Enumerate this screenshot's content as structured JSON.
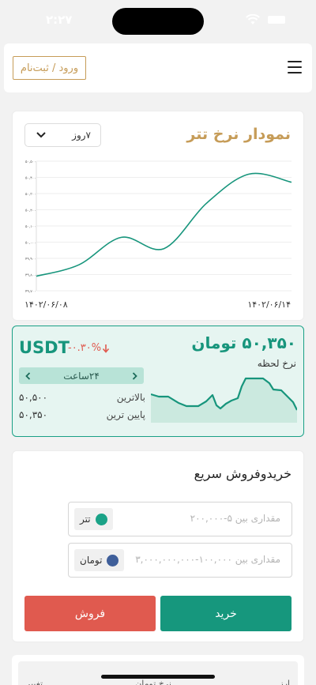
{
  "status_bar": {
    "time": "۲:۲۷"
  },
  "header": {
    "login_label": "ورود / ثبت‌نام"
  },
  "chart_card": {
    "title": "نمودار نرخ تتر",
    "period_selected": "۷روز",
    "start_date": "۱۴۰۲/۰۶/۰۸",
    "end_date": "۱۴۰۲/۰۶/۱۴",
    "y_tick_labels": [
      "۵۰,۵۰۰",
      "۵۰,۴۰۰",
      "۵۰,۳۰۰",
      "۵۰,۲۰۰",
      "۵۰,۱۰۰",
      "۵۰,۰۰۰",
      "۴۹,۹۰۰",
      "۴۹,۸۰۰",
      "۴۹,۷۰۰"
    ],
    "line_color": "#17957c"
  },
  "chart_data": {
    "type": "line",
    "title": "نمودار نرخ تتر",
    "x": [
      "۱۴۰۲/۰۶/۰۸",
      "",
      "",
      "",
      "",
      "",
      "۱۴۰۲/۰۶/۱۴"
    ],
    "series": [
      {
        "values": [
          49790,
          49860,
          50030,
          49960,
          50240,
          50420,
          50370
        ]
      }
    ],
    "ylim": [
      49700,
      50500
    ],
    "grid": true
  },
  "rate_card": {
    "price": "۵۰,۳۵۰ تومان",
    "price_label": "نرخ لحظه",
    "symbol": "USDT",
    "change": "-۰.۳۰%",
    "period_label": "۲۴ساعت",
    "high_label": "بالاترین",
    "high_value": "۵۰,۵۰۰",
    "low_label": "پایین ترین",
    "low_value": "۵۰,۳۵۰",
    "accent_color": "#17957c",
    "negative_color": "#e05a4f"
  },
  "trade_card": {
    "title": "خریدوفروش سریع",
    "tether_field": {
      "placeholder": "مقداری بین ۵-۲۰۰,۰۰۰",
      "unit": "تتر"
    },
    "toman_field": {
      "placeholder": "مقداری بین ۱۰۰,۰۰۰-۳,۰۰۰,۰۰۰,۰۰۰",
      "unit": "تومان"
    },
    "buy_label": "خرید",
    "sell_label": "فروش",
    "buy_color": "#16977d",
    "sell_color": "#e05a4f"
  },
  "table": {
    "headers": [
      "ارز",
      "نرخ تومان",
      "تغییر"
    ]
  }
}
